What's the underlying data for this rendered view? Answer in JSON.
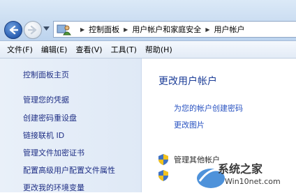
{
  "breadcrumb": [
    "控制面板",
    "用户帐户和家庭安全",
    "用户帐户"
  ],
  "menu": [
    "文件(F)",
    "编辑(E)",
    "查看(V)",
    "工具(T)",
    "帮助(H)"
  ],
  "left_nav": [
    "控制面板主页",
    "管理您的凭据",
    "创建密码重设盘",
    "链接联机 ID",
    "管理文件加密证书",
    "配置高级用户配置文件属性",
    "更改我的环境变量"
  ],
  "main": {
    "heading": "更改用户帐户",
    "links": [
      "为您的帐户创建密码",
      "更改图片"
    ],
    "partial_link": "管理其他帐户"
  },
  "watermark": {
    "text": "系统之家",
    "url": "Win10net.com"
  },
  "colors": {
    "link": "#2852c1",
    "heading": "#1c3d97",
    "nav_bg": "#e4edf8"
  }
}
